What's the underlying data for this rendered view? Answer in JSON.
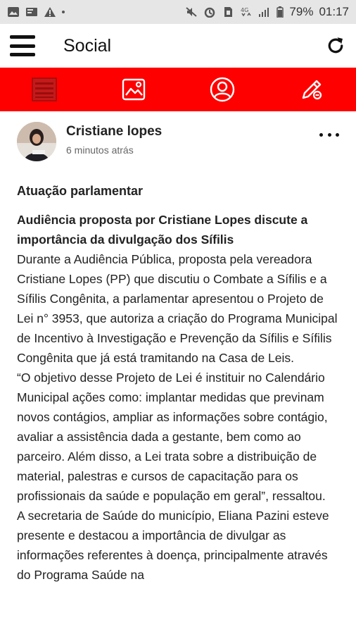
{
  "status_bar": {
    "icons": [
      "image-icon",
      "cast-icon",
      "warning-icon",
      "mute-icon",
      "alarm-icon",
      "sim-icon",
      "network-4g-icon",
      "signal-icon"
    ],
    "battery": "79%",
    "time": "01:17"
  },
  "app_bar": {
    "title": "Social"
  },
  "tabs": [
    {
      "icon": "list-icon",
      "active": true
    },
    {
      "icon": "gallery-icon",
      "active": false
    },
    {
      "icon": "profile-icon",
      "active": false
    },
    {
      "icon": "edit-icon",
      "active": false
    }
  ],
  "post": {
    "author": "Cristiane lopes",
    "time": "6 minutos atrás",
    "heading": "Atuação parlamentar",
    "subheading": "Audiência proposta por Cristiane Lopes discute a importância da divulgação dos Sífilis",
    "paragraph1": "Durante a Audiência Pública, proposta pela vereadora Cristiane Lopes (PP) que discutiu o Combate a Sífilis e a Sífilis Congênita, a parlamentar apresentou o Projeto de Lei n° 3953, que autoriza a criação do Programa Municipal de Incentivo à Investigação e Prevenção da Sífilis e Sífilis Congênita que já está tramitando na Casa de Leis.",
    "paragraph2": "“O objetivo desse Projeto de Lei é instituir no Calendário Municipal ações como: implantar medidas que previnam novos contágios, ampliar as informações sobre contágio, avaliar a assistência dada a gestante, bem como ao parceiro. Além disso, a Lei trata sobre a distribuição de material, palestras e cursos de capacitação para os profissionais da saúde e população em geral”, ressaltou.",
    "paragraph3": "A secretaria de Saúde do município, Eliana Pazini esteve presente e destacou a importância de divulgar as informações referentes à doença, principalmente através do Programa Saúde na"
  },
  "colors": {
    "accent": "#ff0000",
    "status_bar_bg": "#e6e6e6",
    "text": "#212121"
  }
}
